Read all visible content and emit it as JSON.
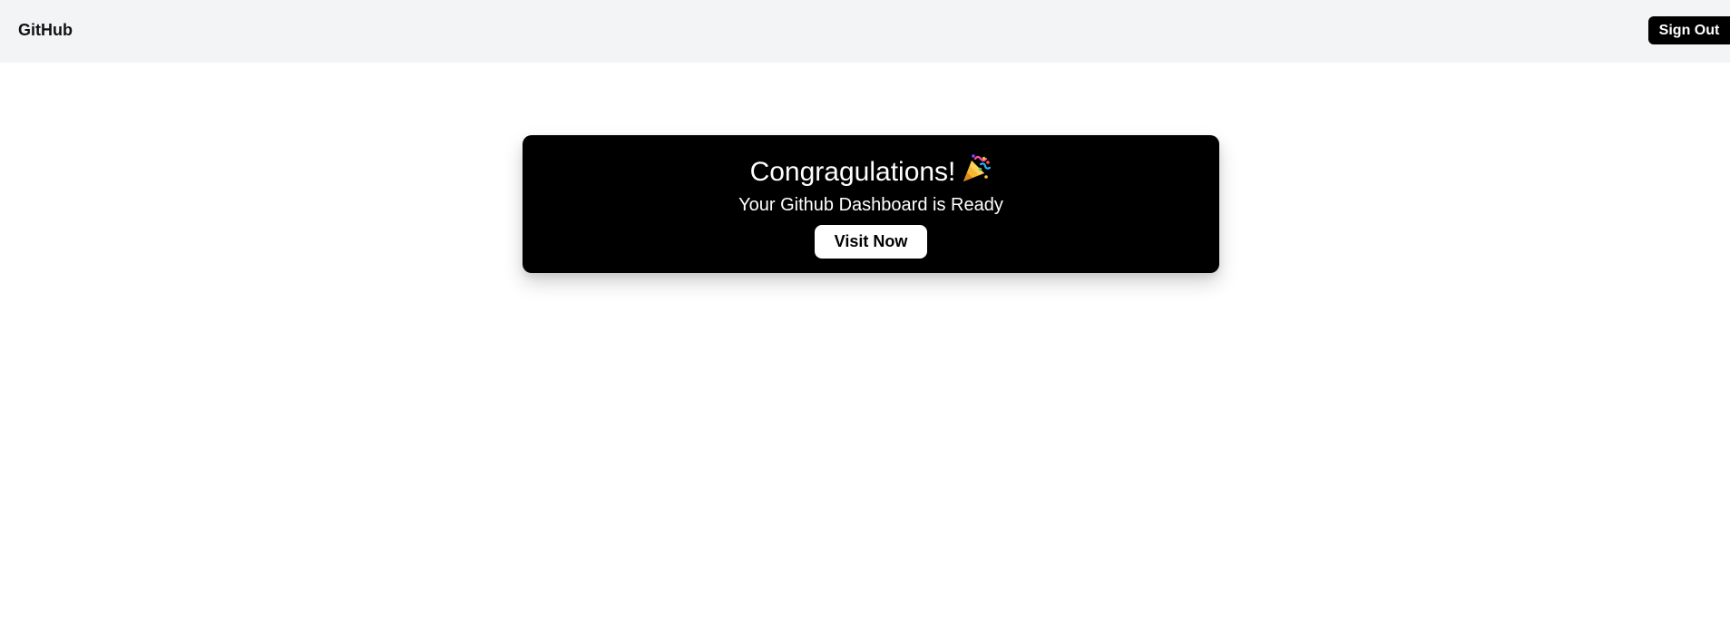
{
  "header": {
    "brand": "GitHub",
    "sign_out_label": "Sign Out"
  },
  "card": {
    "title": "Congragulations!",
    "title_icon": "party-popper-icon",
    "subtitle": "Your Github Dashboard is Ready",
    "button_label": "Visit Now"
  },
  "colors": {
    "header_bg": "#f3f4f6",
    "card_bg": "#000000",
    "button_bg": "#ffffff",
    "text_light": "#ffffff",
    "text_dark": "#111111"
  }
}
